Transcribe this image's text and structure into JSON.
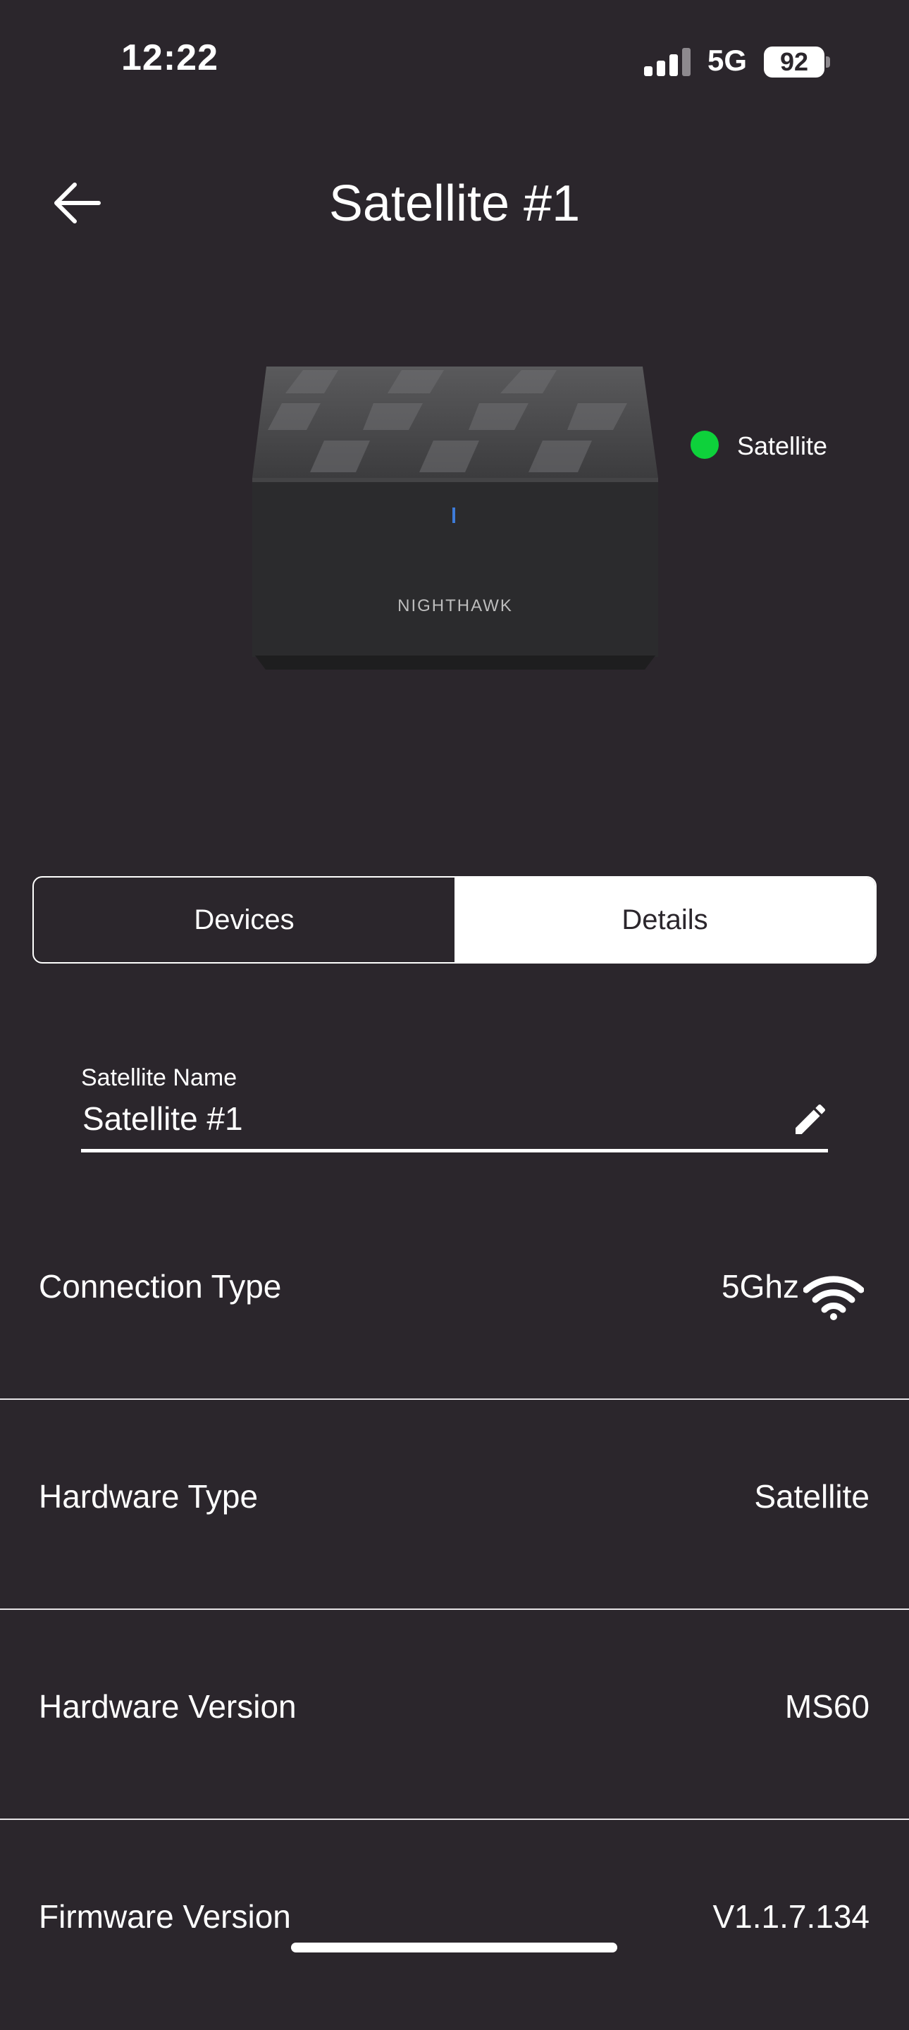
{
  "status_bar": {
    "time": "12:22",
    "network": "5G",
    "battery": "92"
  },
  "header": {
    "title": "Satellite #1"
  },
  "device": {
    "brand": "NIGHTHAWK",
    "status_label": "Satellite",
    "status_color": "#0ed13b"
  },
  "tabs": [
    {
      "label": "Devices",
      "active": false
    },
    {
      "label": "Details",
      "active": true
    }
  ],
  "name_field": {
    "label": "Satellite Name",
    "value": "Satellite #1"
  },
  "details": [
    {
      "label": "Connection Type",
      "value": "5Ghz",
      "icon": "wifi-icon"
    },
    {
      "label": "Hardware Type",
      "value": "Satellite"
    },
    {
      "label": "Hardware Version",
      "value": "MS60"
    },
    {
      "label": "Firmware Version",
      "value": "V1.1.7.134"
    }
  ],
  "colors": {
    "background": "#2b262c",
    "text": "#ffffff"
  }
}
